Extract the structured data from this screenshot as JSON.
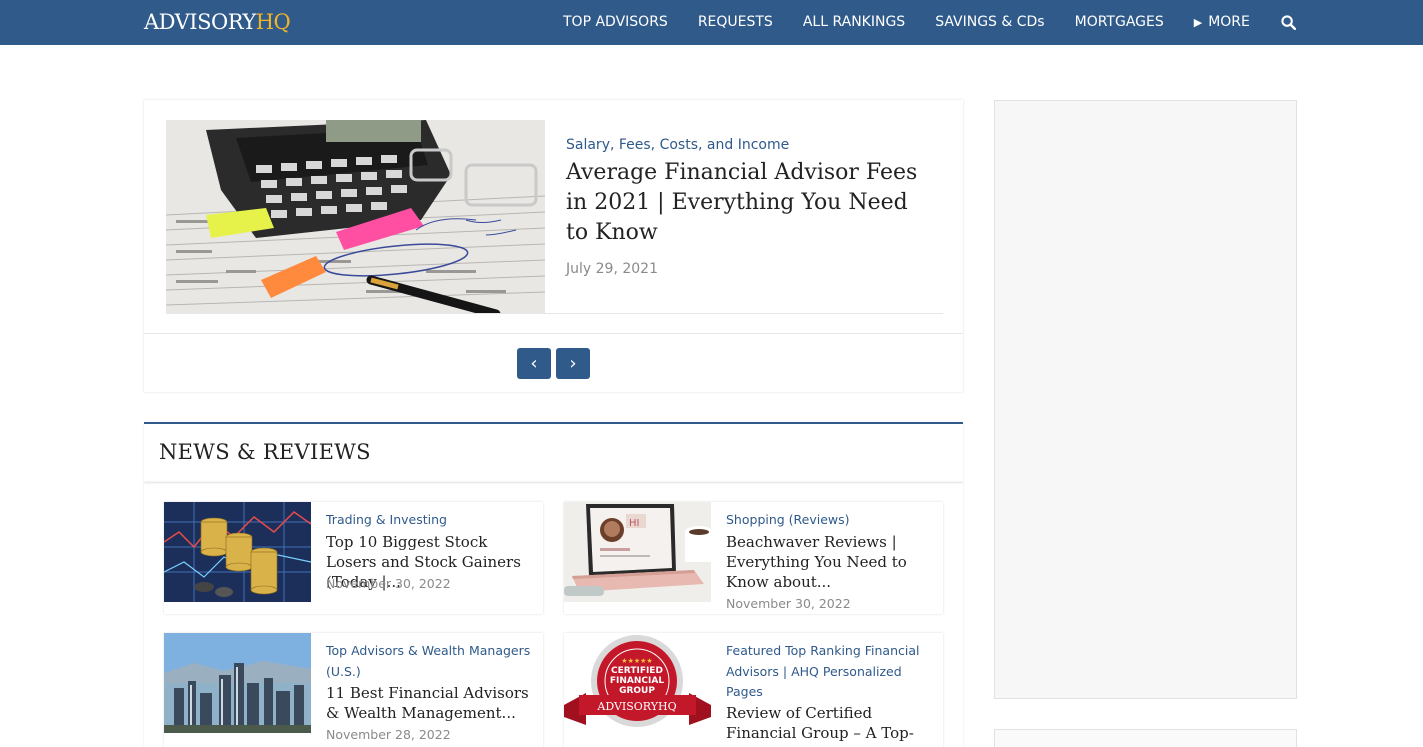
{
  "brand": {
    "logo_part1": "ADVISORY",
    "logo_part2": "HQ"
  },
  "nav": {
    "items": [
      "TOP ADVISORS",
      "REQUESTS",
      "ALL RANKINGS",
      "SAVINGS & CDs",
      "MORTGAGES"
    ],
    "more_label": "MORE",
    "more_icon": "triangle-right-icon",
    "search_icon": "search-icon"
  },
  "featured": {
    "category": "Salary, Fees, Costs, and Income",
    "title": "Average Financial Advisor Fees in 2021 | Everything You Need to Know",
    "date": "July 29, 2021",
    "prev_label": "‹",
    "next_label": "›"
  },
  "news": {
    "heading": "NEWS & REVIEWS",
    "items": [
      {
        "category": "Trading & Investing",
        "title": "Top 10 Biggest Stock Losers and Stock Gainers (Today |...",
        "date": "November 30, 2022"
      },
      {
        "category": "Shopping (Reviews)",
        "title": "Beachwaver Reviews | Everything You Need to Know about...",
        "date": "November 30, 2022"
      },
      {
        "category": "Top Advisors & Wealth Managers (U.S.)",
        "title": "11 Best Financial Advisors & Wealth Management...",
        "date": "November 28, 2022"
      },
      {
        "category": "Featured Top Ranking Financial Advisors | AHQ Personalized Pages",
        "title": "Review of Certified Financial Group – A Top-Ranked...",
        "date": ""
      }
    ]
  },
  "badge": {
    "line1": "CERTIFIED",
    "line2": "FINANCIAL",
    "line3": "GROUP",
    "ribbon": "ADVISORYHQ",
    "stars": "★★★★★"
  },
  "colors": {
    "brand_blue": "#2f5a8a",
    "brand_gold": "#f0b429"
  }
}
